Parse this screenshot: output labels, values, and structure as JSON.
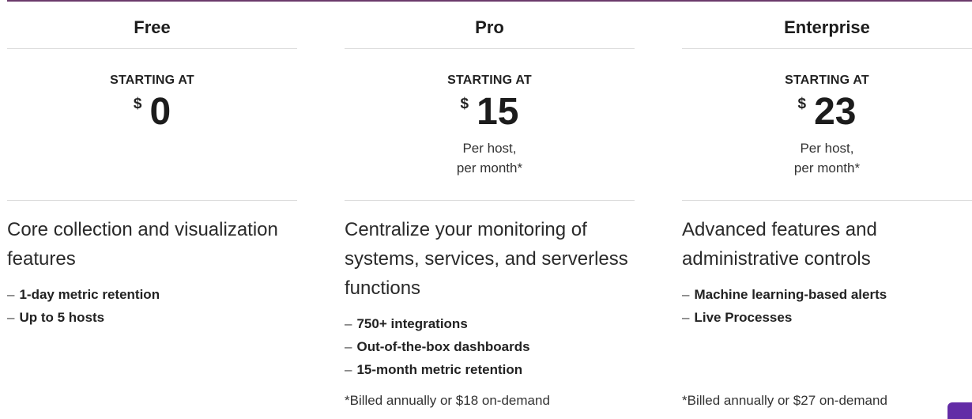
{
  "plans": [
    {
      "name": "Free",
      "starting_label": "STARTING AT",
      "currency": "$",
      "amount": "0",
      "billing_line1": "",
      "billing_line2": "",
      "description": "Core collection and visualization features",
      "features": [
        "1-day metric retention",
        "Up to 5 hosts"
      ],
      "footnote": ""
    },
    {
      "name": "Pro",
      "starting_label": "STARTING AT",
      "currency": "$",
      "amount": "15",
      "billing_line1": "Per host,",
      "billing_line2": "per month*",
      "description": "Centralize your monitoring of systems, services, and serverless functions",
      "features": [
        "750+ integrations",
        "Out-of-the-box dashboards",
        "15-month metric retention"
      ],
      "footnote": "*Billed annually or $18 on-demand"
    },
    {
      "name": "Enterprise",
      "starting_label": "STARTING AT",
      "currency": "$",
      "amount": "23",
      "billing_line1": "Per host,",
      "billing_line2": "per month*",
      "description": "Advanced features and administrative controls",
      "features": [
        "Machine learning-based alerts",
        "Live Processes"
      ],
      "footnote": "*Billed annually or $27 on-demand"
    }
  ],
  "list_dash": "–",
  "colors": {
    "accent_rule": "#6b3a6b",
    "chat_tab": "#632ca6"
  }
}
